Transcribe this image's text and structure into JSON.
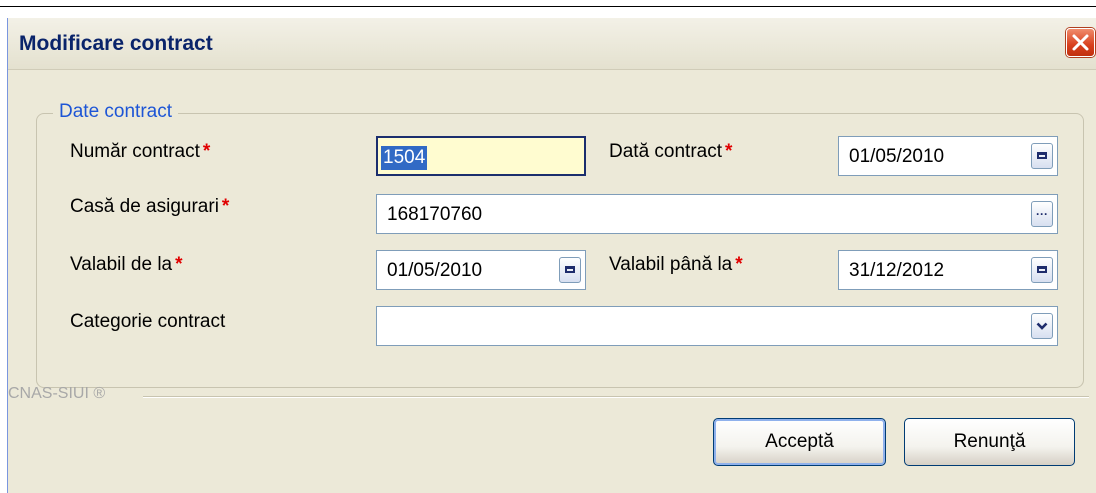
{
  "window": {
    "title": "Modificare contract"
  },
  "group": {
    "legend": "Date contract"
  },
  "fields": {
    "contract_number": {
      "label": "Număr contract",
      "required_mark": "*",
      "value": "1504"
    },
    "contract_date": {
      "label": "Dată contract",
      "required_mark": "*",
      "value": "01/05/2010"
    },
    "insurance_house": {
      "label": "Casă de asigurari",
      "required_mark": "*",
      "value": "168170760"
    },
    "valid_from": {
      "label": "Valabil de la",
      "required_mark": "*",
      "value": "01/05/2010"
    },
    "valid_to": {
      "label": "Valabil până la",
      "required_mark": "*",
      "value": "31/12/2012"
    },
    "category": {
      "label": "Categorie contract",
      "value": ""
    }
  },
  "footer": {
    "brand": "CNAS-SIUI ®"
  },
  "buttons": {
    "accept": "Acceptă",
    "cancel": "Renunţă"
  },
  "icons": {
    "close": "close-icon",
    "date_picker": "calendar-icon",
    "lookup": "ellipsis-icon",
    "dropdown": "chevron-down-icon"
  },
  "colors": {
    "window_bg": "#ece9d8",
    "title_text": "#0a246a",
    "legend_text": "#1d55d6",
    "required": "#e00000",
    "close_button": "#d8401e",
    "active_field_bg": "#fffcd0",
    "selection": "#316ac5"
  }
}
